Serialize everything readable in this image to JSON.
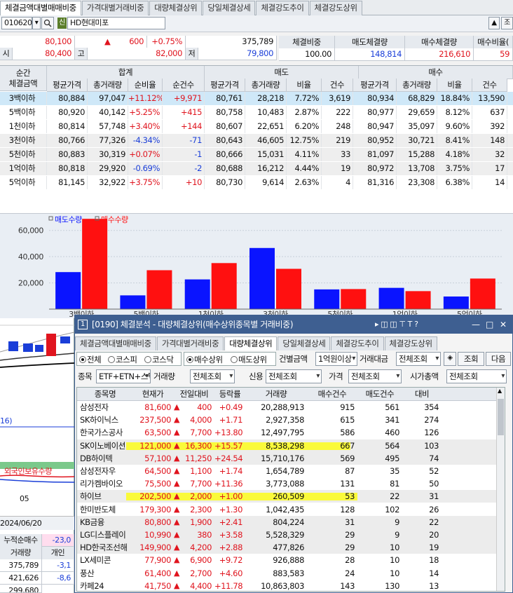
{
  "main_tabs": [
    "체결금액대별매매비중",
    "가격대별거래비중",
    "대량체결상위",
    "당일체결상세",
    "체결강도추이",
    "체결강도상위"
  ],
  "toolbar": {
    "code": "010620",
    "badge": "신",
    "stock_name": "HD현대미포",
    "up_btn": "▲",
    "right_btn": "조"
  },
  "quote": {
    "price": "80,100",
    "change_mark": "▲",
    "change": "600",
    "change_pct": "+0.75%",
    "volume": "375,789",
    "open_label": "시",
    "open": "80,400",
    "high_label": "고",
    "high": "82,000",
    "low_label": "저",
    "low": "79,800"
  },
  "summary": {
    "headers": [
      "체결비중",
      "매도체결량",
      "매수체결량",
      "매수비율("
    ],
    "values": [
      "100.00",
      "148,814",
      "216,610",
      "59"
    ]
  },
  "table": {
    "group_headers": {
      "amount": "순간\n체결금액",
      "total": "합계",
      "sell": "매도",
      "buy": "매수"
    },
    "sub_headers": [
      "평균가격",
      "총거래량",
      "순비율",
      "순건수",
      "평균가격",
      "총거래량",
      "비율",
      "건수",
      "평균가격",
      "총거래량",
      "비율",
      "건수"
    ],
    "rows": [
      [
        "3백이하",
        "80,884",
        "97,047",
        "+11.12%",
        "+9,971",
        "80,761",
        "28,218",
        "7.72%",
        "3,619",
        "80,934",
        "68,829",
        "18.84%",
        "13,590"
      ],
      [
        "5백이하",
        "80,920",
        "40,142",
        "+5.25%",
        "+415",
        "80,758",
        "10,483",
        "2.87%",
        "222",
        "80,977",
        "29,659",
        "8.12%",
        "637"
      ],
      [
        "1천이하",
        "80,814",
        "57,748",
        "+3.40%",
        "+144",
        "80,607",
        "22,651",
        "6.20%",
        "248",
        "80,947",
        "35,097",
        "9.60%",
        "392"
      ],
      [
        "3천이하",
        "80,766",
        "77,326",
        "-4.34%",
        "-71",
        "80,643",
        "46,605",
        "12.75%",
        "219",
        "80,952",
        "30,721",
        "8.41%",
        "148"
      ],
      [
        "5천이하",
        "80,883",
        "30,319",
        "+0.07%",
        "-1",
        "80,666",
        "15,031",
        "4.11%",
        "33",
        "81,097",
        "15,288",
        "4.18%",
        "32"
      ],
      [
        "1억이하",
        "80,818",
        "29,920",
        "-0.69%",
        "-2",
        "80,688",
        "16,212",
        "4.44%",
        "19",
        "80,972",
        "13,708",
        "3.75%",
        "17"
      ],
      [
        "5억이하",
        "81,145",
        "32,922",
        "+3.75%",
        "+10",
        "80,730",
        "9,614",
        "2.63%",
        "4",
        "81,316",
        "23,308",
        "6.38%",
        "14"
      ]
    ]
  },
  "chart_data": {
    "type": "bar",
    "categories": [
      "3백이하",
      "5백이하",
      "1천이하",
      "3천이하",
      "5천이하",
      "1억이하",
      "5억이하"
    ],
    "series": [
      {
        "name": "매도수량",
        "color": "#0a14ff",
        "values": [
          28218,
          10483,
          22651,
          46605,
          15031,
          16212,
          9614
        ]
      },
      {
        "name": "매수수량",
        "color": "#ff1010",
        "values": [
          68829,
          29659,
          35097,
          30721,
          15288,
          13708,
          23308
        ]
      }
    ],
    "yticks": [
      "60,000",
      "40,000",
      "20,000"
    ],
    "ylim": [
      0,
      70000
    ]
  },
  "left_panel": {
    "label_16": "16)",
    "foreign_label": "외국인보유수량",
    "date_05": "05",
    "date": "2024/06/20",
    "net_label": "누적순매수",
    "net_value": "-23,0",
    "vol_label": "거래량",
    "indiv_label": "개인",
    "rows": [
      [
        "375,789",
        "-3,1"
      ],
      [
        "421,626",
        "-8,6"
      ],
      [
        "299,680",
        ""
      ]
    ]
  },
  "window": {
    "title": "[0190] 체결분석 - 대량체결상위(매수상위종목별 거래비중)",
    "tabs": [
      "체결금액대별매매비중",
      "가격대별거래비중",
      "대량체결상위",
      "당일체결상세",
      "체결강도추이",
      "체결강도상위"
    ],
    "market_opts": [
      "전체",
      "코스피",
      "코스닥"
    ],
    "side_opts": [
      "매수상위",
      "매도상위"
    ],
    "amount_label": "건별금액",
    "amount_value": "1억원이상",
    "trade_amt_label": "거래대금",
    "trade_amt_value": "전체조회",
    "query_btn": "조회",
    "next_btn": "다음",
    "type_label": "종목",
    "type_value": "ETF+ETN+스팩",
    "vol_label": "거래량",
    "vol_value": "전체조회",
    "credit_label": "신용",
    "credit_value": "전체조회",
    "price_label": "가격",
    "price_value": "전체조회",
    "mcap_label": "시가총액",
    "mcap_value": "전체조회",
    "headers": [
      "종목명",
      "현재가",
      "전일대비",
      "등락률",
      "거래량",
      "매수건수",
      "매도건수",
      "대비"
    ],
    "rows": [
      [
        "삼성전자",
        "81,600",
        "400",
        "+0.49",
        "20,288,913",
        "915",
        "561",
        "354"
      ],
      [
        "SK하이닉스",
        "237,500",
        "4,000",
        "+1.71",
        "2,927,358",
        "615",
        "341",
        "274"
      ],
      [
        "한국가스공사",
        "63,500",
        "7,700",
        "+13.80",
        "12,497,795",
        "586",
        "460",
        "126"
      ],
      [
        "SK이노베이션",
        "121,000",
        "16,300",
        "+15.57",
        "8,538,298",
        "667",
        "564",
        "103"
      ],
      [
        "DB하이텍",
        "57,100",
        "11,250",
        "+24.54",
        "15,710,176",
        "569",
        "495",
        "74"
      ],
      [
        "삼성전자우",
        "64,500",
        "1,100",
        "+1.74",
        "1,654,789",
        "87",
        "35",
        "52"
      ],
      [
        "리가켐바이오",
        "75,500",
        "7,700",
        "+11.36",
        "3,773,088",
        "131",
        "81",
        "50"
      ],
      [
        "하이브",
        "202,500",
        "2,000",
        "+1.00",
        "260,509",
        "53",
        "22",
        "31"
      ],
      [
        "한미반도체",
        "179,300",
        "2,300",
        "+1.30",
        "1,042,435",
        "128",
        "102",
        "26"
      ],
      [
        "KB금융",
        "80,800",
        "1,900",
        "+2.41",
        "804,224",
        "31",
        "9",
        "22"
      ],
      [
        "LG디스플레이",
        "10,990",
        "380",
        "+3.58",
        "5,528,329",
        "29",
        "9",
        "20"
      ],
      [
        "HD한국조선해",
        "149,900",
        "4,200",
        "+2.88",
        "477,826",
        "29",
        "10",
        "19"
      ],
      [
        "LX세미콘",
        "77,900",
        "6,900",
        "+9.72",
        "926,888",
        "28",
        "10",
        "18"
      ],
      [
        "풍산",
        "61,400",
        "2,700",
        "+4.60",
        "883,583",
        "24",
        "10",
        "14"
      ],
      [
        "카페24",
        "41,750",
        "4,400",
        "+11.78",
        "10,863,803",
        "143",
        "130",
        "13"
      ]
    ]
  }
}
